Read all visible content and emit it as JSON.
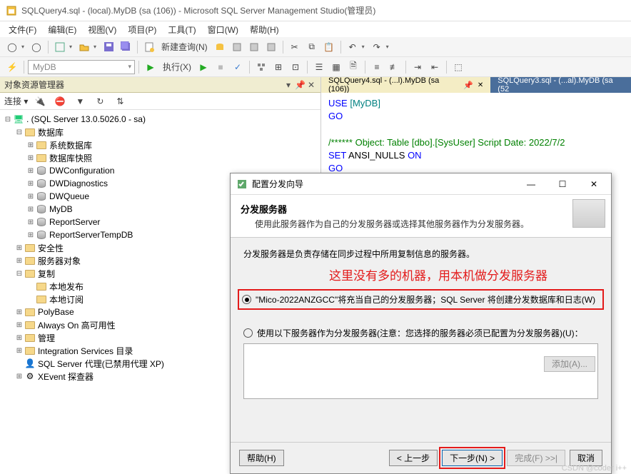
{
  "window": {
    "title": "SQLQuery4.sql - (local).MyDB (sa (106)) - Microsoft SQL Server Management Studio(管理员)"
  },
  "menu": {
    "file": "文件(F)",
    "edit": "编辑(E)",
    "view": "视图(V)",
    "project": "项目(P)",
    "tools": "工具(T)",
    "window": "窗口(W)",
    "help": "帮助(H)"
  },
  "toolbar": {
    "new_query": "新建查询(N)",
    "db_selector": "MyDB",
    "execute": "执行(X)"
  },
  "explorer": {
    "title": "对象资源管理器",
    "connect_label": "连接 ▾",
    "root": ". (SQL Server 13.0.5026.0 - sa)",
    "nodes": {
      "databases": "数据库",
      "sys_db": "系统数据库",
      "db_snapshot": "数据库快照",
      "dwconfig": "DWConfiguration",
      "dwdiag": "DWDiagnostics",
      "dwqueue": "DWQueue",
      "mydb": "MyDB",
      "reportserver": "ReportServer",
      "reportservertemp": "ReportServerTempDB",
      "security": "安全性",
      "server_objects": "服务器对象",
      "replication": "复制",
      "local_pub": "本地发布",
      "local_sub": "本地订阅",
      "polybase": "PolyBase",
      "alwayson": "Always On 高可用性",
      "management": "管理",
      "integration": "Integration Services 目录",
      "agent": "SQL Server 代理(已禁用代理 XP)",
      "xevent": "XEvent 探查器"
    }
  },
  "tabs": {
    "tab1": "SQLQuery4.sql - (...l).MyDB (sa (106))",
    "tab2": "SQLQuery3.sql - (...al).MyDB (sa (52"
  },
  "sql": {
    "line1a": "USE",
    "line1b": " [MyDB]",
    "line2": "GO",
    "line3a": "/****** Object:  Table [dbo].[SysUser]    Script Date: 2022/7/2",
    "line4a": "SET",
    "line4b": " ANSI_NULLS ",
    "line4c": "ON",
    "line5": "GO"
  },
  "dialog": {
    "title": "配置分发向导",
    "header": "分发服务器",
    "header_sub": "使用此服务器作为自己的分发服务器或选择其他服务器作为分发服务器。",
    "desc": "分发服务器是负责存储在同步过程中所用复制信息的服务器。",
    "red_note": "这里没有多的机器，用本机做分发服务器",
    "option1": "\"Mico-2022ANZGCC\"将充当自己的分发服务器；SQL Server 将创建分发数据库和日志(W)",
    "option2": "使用以下服务器作为分发服务器(注意：您选择的服务器必须已配置为分发服务器)(U)：",
    "add_btn": "添加(A)...",
    "help": "帮助(H)",
    "back": "< 上一步",
    "next": "下一步(N) >",
    "finish": "完成(F) >>|",
    "cancel": "取消"
  },
  "watermark": "CSDN @coder i++"
}
